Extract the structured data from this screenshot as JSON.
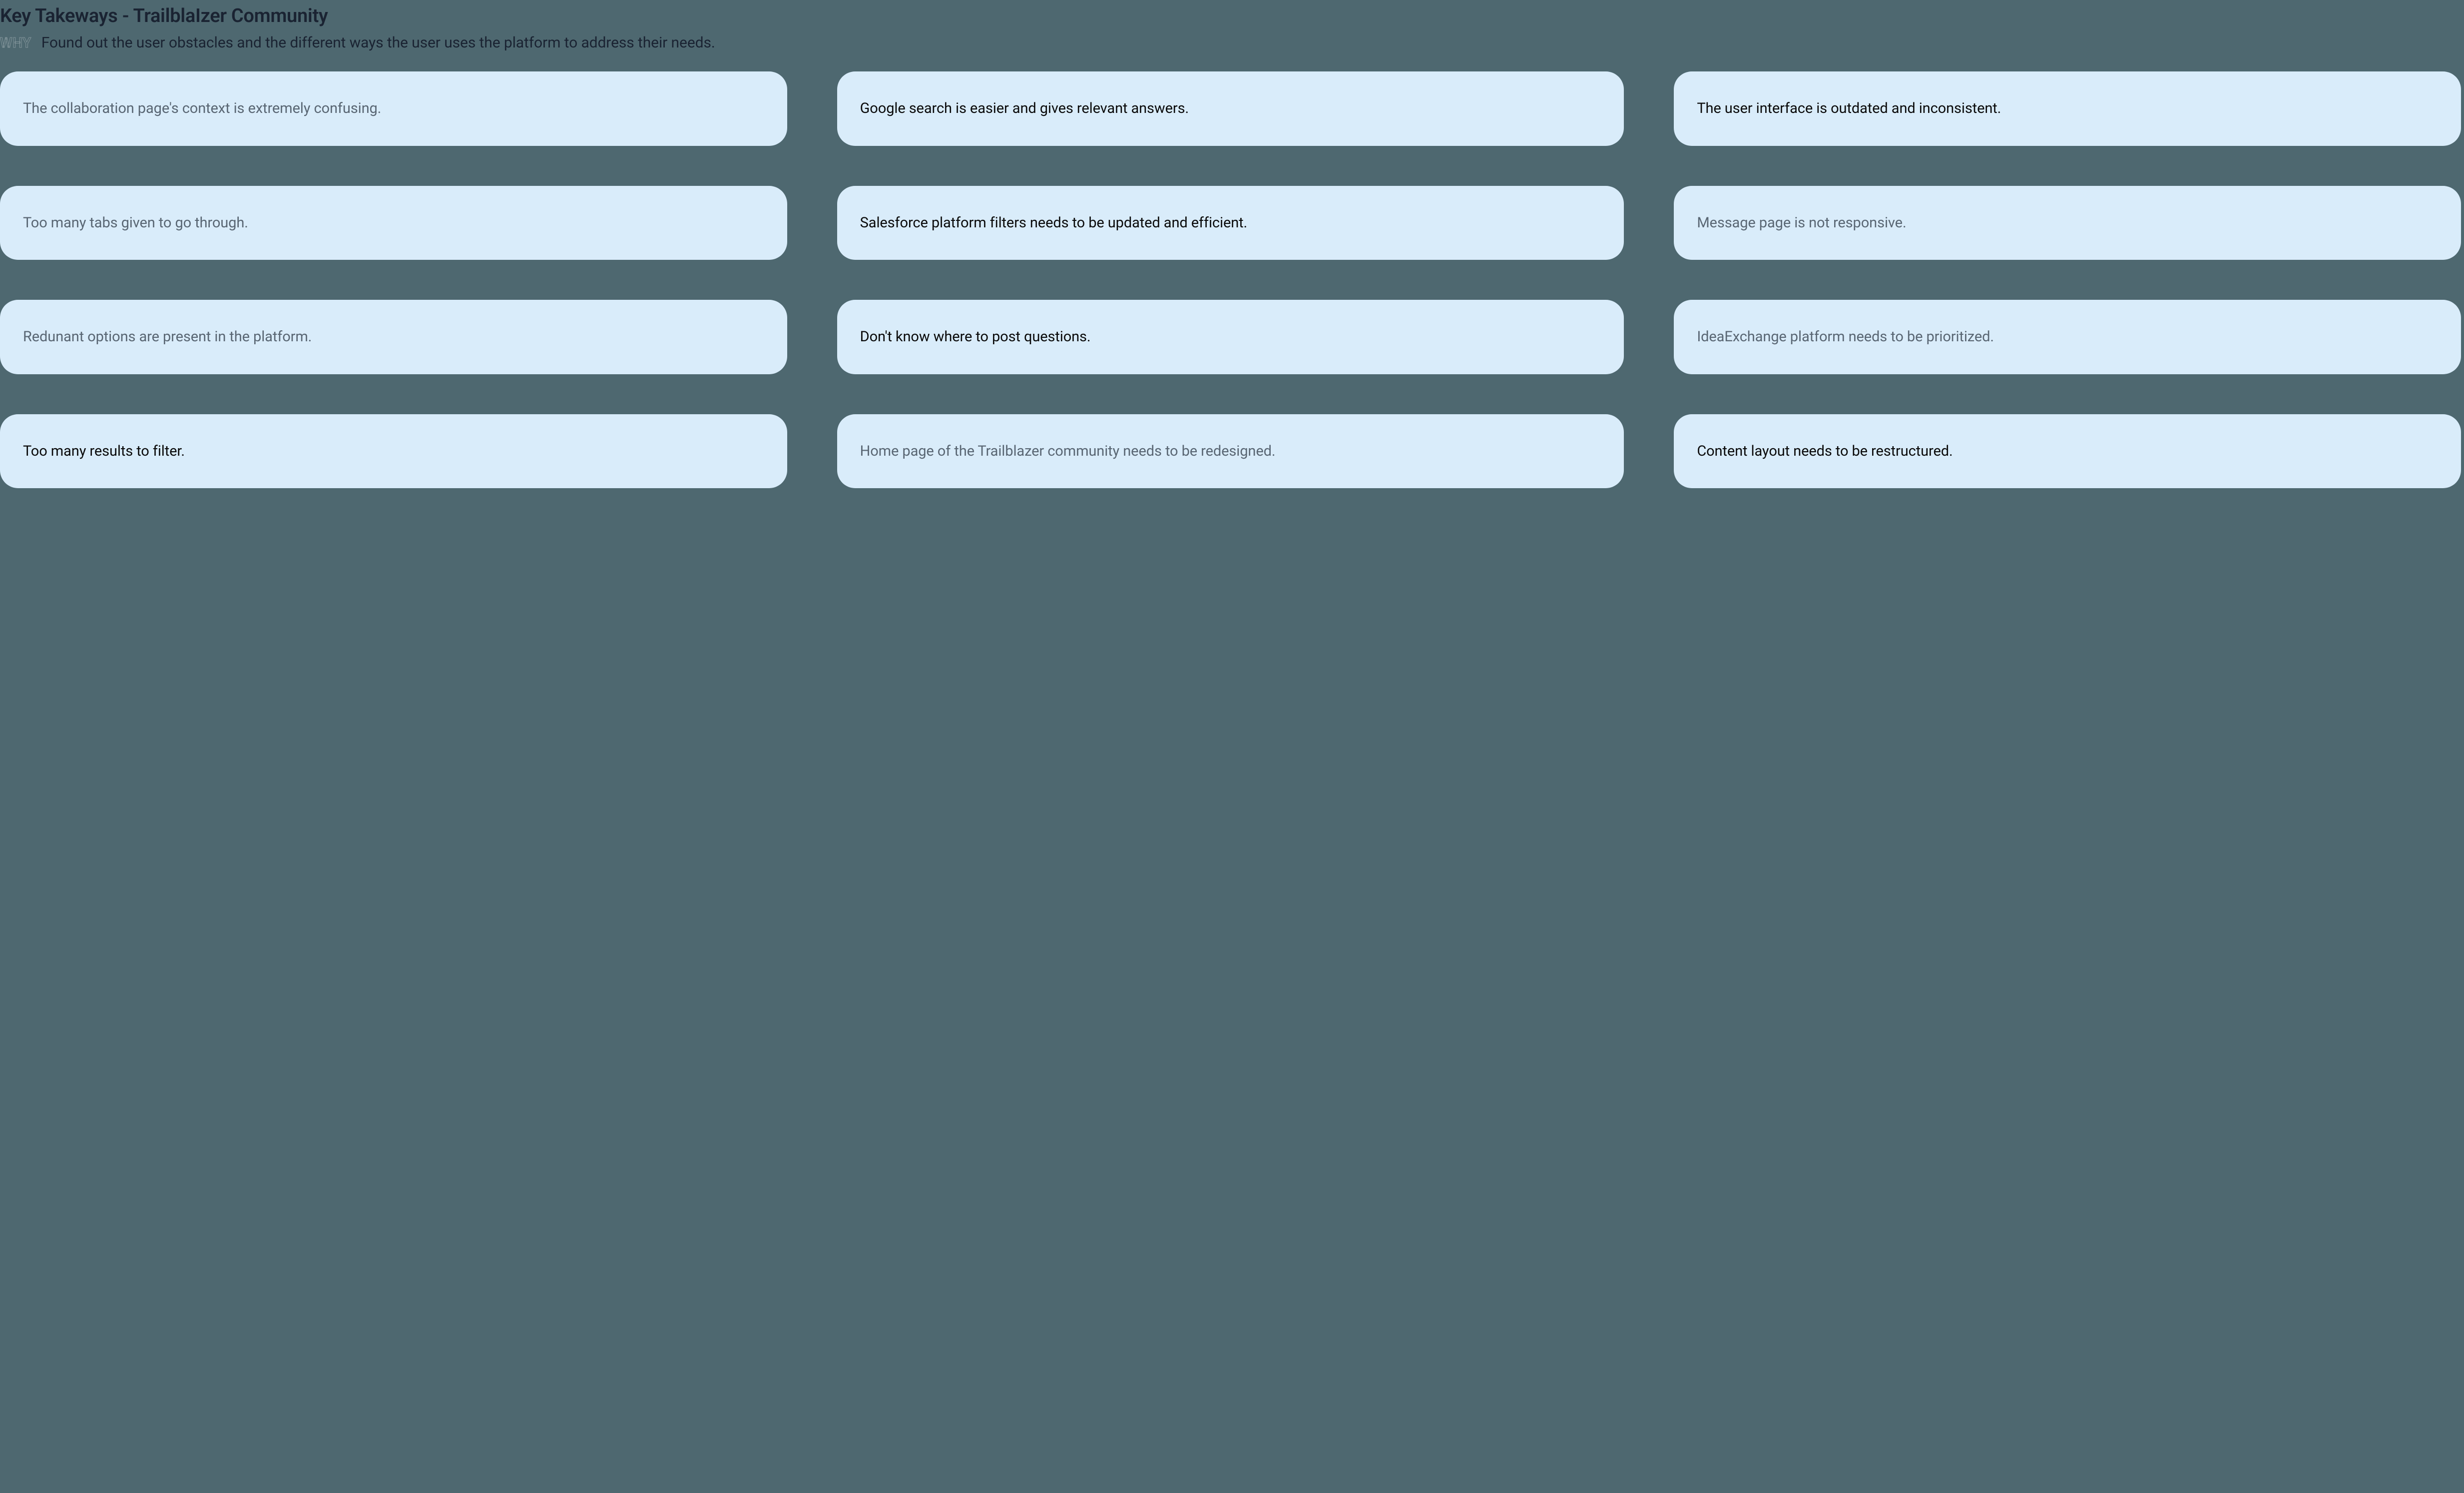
{
  "header": {
    "title": "Key Takeways - TrailblaIzer Community",
    "why_label": "WHY",
    "subtitle": "Found out the user obstacles and the different ways the user uses the platform to address their needs."
  },
  "cards": [
    {
      "text": "The collaboration page's context is extremely confusing.",
      "tone": "muted"
    },
    {
      "text": "Google search is easier and gives relevant answers.",
      "tone": "dark"
    },
    {
      "text": "The user interface is outdated and inconsistent.",
      "tone": "dark"
    },
    {
      "text": "Too many tabs given to go through.",
      "tone": "muted"
    },
    {
      "text": "Salesforce platform filters needs to be updated and efficient.",
      "tone": "dark"
    },
    {
      "text": "Message page is not responsive.",
      "tone": "muted"
    },
    {
      "text": "Redunant options are present in the platform.",
      "tone": "muted"
    },
    {
      "text": "Don't know where to post questions.",
      "tone": "dark"
    },
    {
      "text": "IdeaExchange platform needs to be prioritized.",
      "tone": "muted"
    },
    {
      "text": "Too many results to filter.",
      "tone": "dark"
    },
    {
      "text": "Home page of the Trailblazer community needs to be redesigned.",
      "tone": "muted"
    },
    {
      "text": "Content layout needs to be restructured.",
      "tone": "dark"
    }
  ]
}
